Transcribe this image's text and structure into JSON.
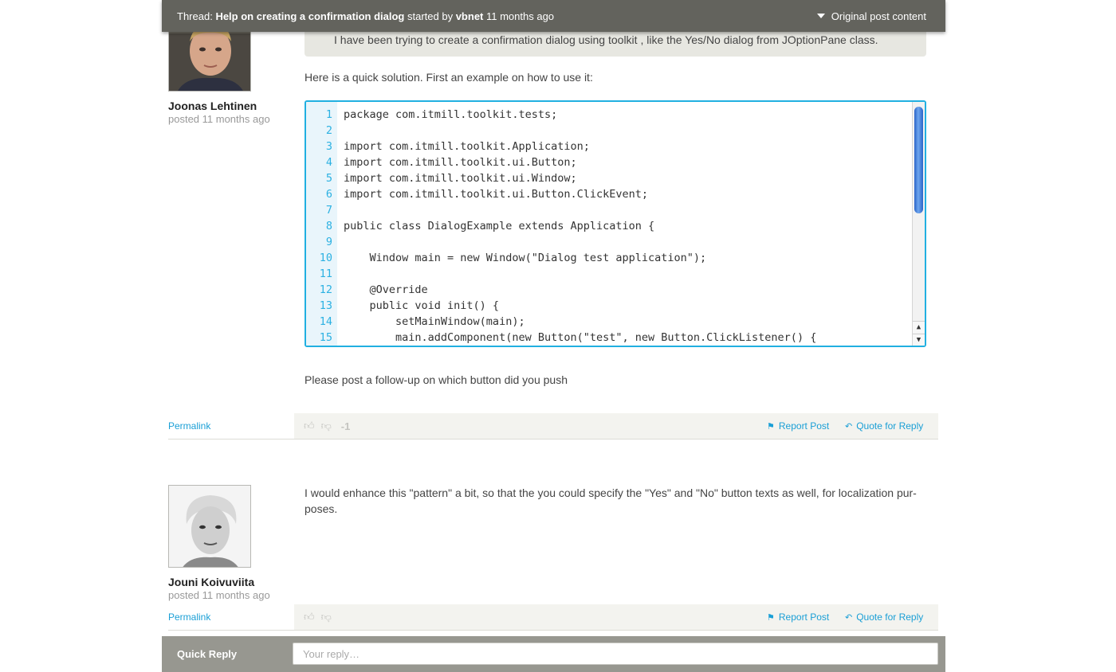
{
  "thread": {
    "prefix": "Thread:",
    "title": "Help on creating a confirmation dialog",
    "started_by": "started by",
    "author": "vbnet",
    "age": "11 months ago",
    "toggle_label": "Original post content"
  },
  "posts": [
    {
      "author": "Joonas Lehtinen",
      "posted": "posted 11 months ago",
      "quote": "I have been trying to create a confirmation dialog using toolkit , like the Yes/No dialog from JOptionPane class.",
      "intro": "Here is a quick solution. First an example on how to use it:",
      "code_lines": [
        {
          "n": "1",
          "t": "package com.itmill.toolkit.tests;"
        },
        {
          "n": "2",
          "t": ""
        },
        {
          "n": "3",
          "t": "import com.itmill.toolkit.Application;"
        },
        {
          "n": "4",
          "t": "import com.itmill.toolkit.ui.Button;"
        },
        {
          "n": "5",
          "t": "import com.itmill.toolkit.ui.Window;"
        },
        {
          "n": "6",
          "t": "import com.itmill.toolkit.ui.Button.ClickEvent;"
        },
        {
          "n": "7",
          "t": ""
        },
        {
          "n": "8",
          "t": "public class DialogExample extends Application {"
        },
        {
          "n": "9",
          "t": ""
        },
        {
          "n": "10",
          "t": "    Window main = new Window(\"Dialog test application\");"
        },
        {
          "n": "11",
          "t": ""
        },
        {
          "n": "12",
          "t": "    @Override"
        },
        {
          "n": "13",
          "t": "    public void init() {"
        },
        {
          "n": "14",
          "t": "        setMainWindow(main);"
        },
        {
          "n": "15",
          "t": "        main.addComponent(new Button(\"test\", new Button.ClickListener() {"
        }
      ],
      "outro": "Please post a follow-up on which button did you push",
      "score": "-1"
    },
    {
      "author": "Jouni Koivuviita",
      "posted": "posted 11 months ago",
      "body_line1": "I would enhance this \"pattern\" a bit, so that the you could specify the \"Yes\" and \"No\" button texts as well, for localization pur-",
      "body_line2": "poses."
    }
  ],
  "actions": {
    "permalink": "Permalink",
    "report": "Report Post",
    "quote": "Quote for Reply"
  },
  "quick_reply": {
    "label": "Quick Reply",
    "placeholder": "Your reply…"
  },
  "colors": {
    "accent": "#1a9fd6",
    "code_border": "#21b0e1",
    "score": "#e07a18",
    "topbar": "#63635d"
  }
}
